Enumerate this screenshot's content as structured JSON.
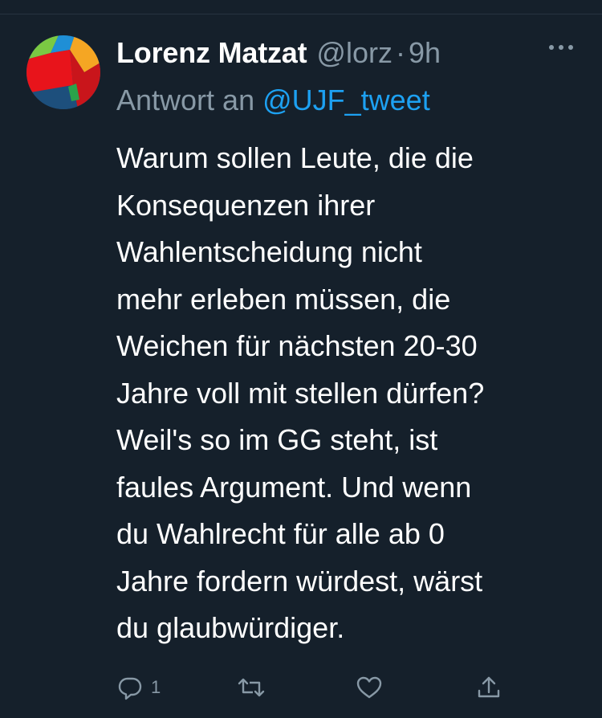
{
  "tweet": {
    "author_name": "Lorenz Matzat",
    "handle": "@lorz",
    "separator": "·",
    "time": "9h",
    "reply_prefix": "Antwort an",
    "reply_target": "@UJF_tweet",
    "lines": [
      "Warum sollen Leute, die die",
      "Konsequenzen ihrer",
      "Wahlentscheidung nicht",
      "mehr erleben müssen, die",
      "Weichen für nächsten 20-30",
      "Jahre voll mit stellen dürfen?",
      "Weil's so im GG steht, ist",
      "faules Argument. Und wenn",
      "du Wahlrecht für alle ab 0",
      "Jahre fordern würdest, wärst",
      "du glaubwürdiger."
    ]
  },
  "actions": {
    "reply_count": "1"
  },
  "icons": {
    "more": "more-icon",
    "reply": "reply-icon",
    "retweet": "retweet-icon",
    "like": "like-icon",
    "share": "share-icon"
  },
  "colors": {
    "background": "#15202b",
    "text_primary": "#ffffff",
    "text_secondary": "#8899a6",
    "link": "#1da1f2"
  }
}
